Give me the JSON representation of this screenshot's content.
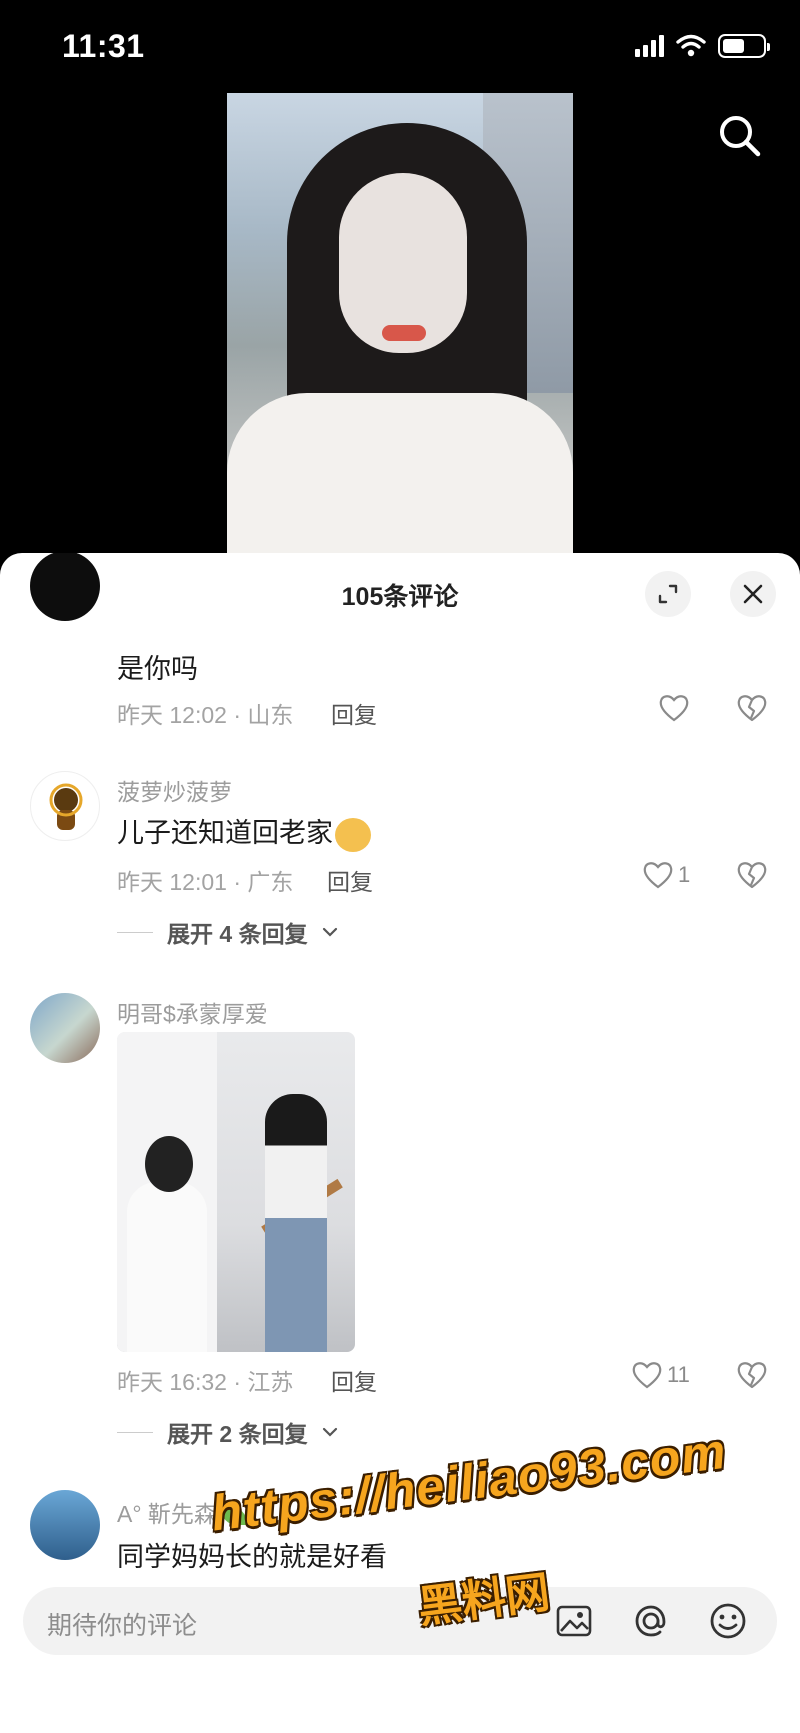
{
  "status_bar": {
    "time": "11:31",
    "battery_level": 0.55
  },
  "video": {
    "description_icon": "video-frame"
  },
  "sheet": {
    "title": "105条评论"
  },
  "comments": [
    {
      "username": "",
      "text": "是你吗",
      "time_location": "昨天 12:02 · 山东",
      "reply_label": "回复",
      "likes": ""
    },
    {
      "username": "菠萝炒菠萝",
      "text": "儿子还知道回老家",
      "time_location": "昨天 12:01 · 广东",
      "reply_label": "回复",
      "likes": "1",
      "expand_label": "展开 4 条回复"
    },
    {
      "username": "明哥$承蒙厚爱",
      "text": "",
      "time_location": "昨天 16:32 · 江苏",
      "reply_label": "回复",
      "likes": "11",
      "expand_label": "展开 2 条回复"
    },
    {
      "username": "A° 靳先森",
      "text": "同学妈妈长的就是好看"
    }
  ],
  "input_bar": {
    "placeholder": "期待你的评论"
  },
  "watermark": {
    "url": "https://heiliao93.com",
    "site_name": "黑料网"
  },
  "colors": {
    "watermark": "#f6a51e",
    "sheet_bg": "#ffffff",
    "page_bg": "#000000"
  }
}
